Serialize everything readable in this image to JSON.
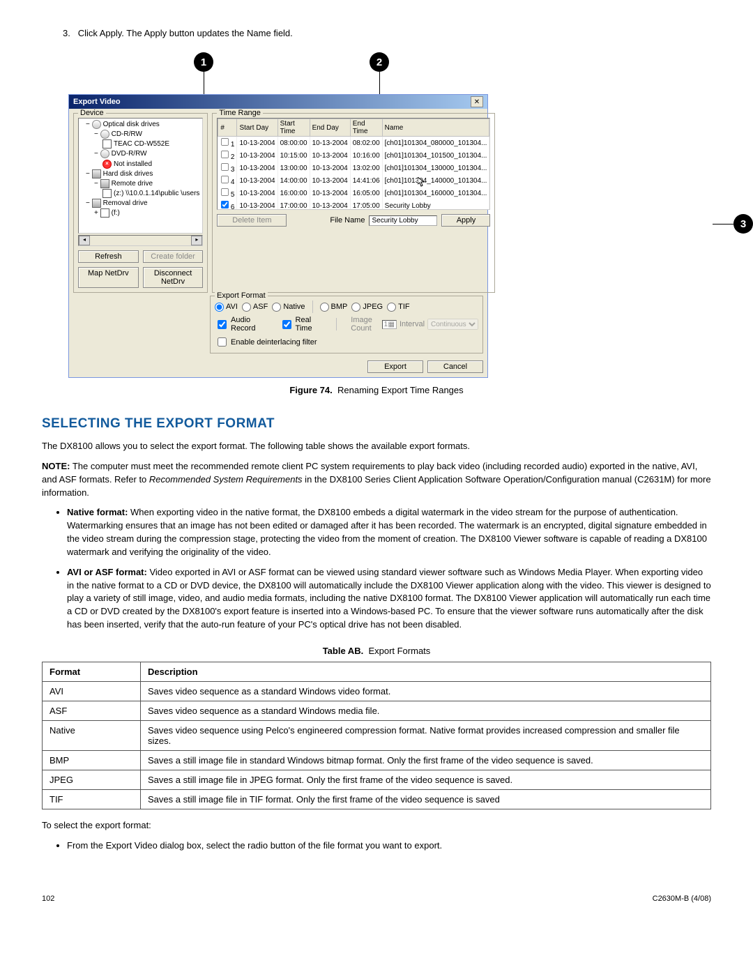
{
  "step": {
    "num": "3.",
    "text": "Click Apply. The Apply button updates the Name field."
  },
  "callouts": {
    "c1": "1",
    "c2": "2",
    "c3": "3"
  },
  "dialog": {
    "title": "Export Video",
    "close": "✕",
    "device_label": "Device",
    "tree": {
      "optical": "Optical disk drives",
      "cdrrw": "CD-R/RW",
      "teac": "TEAC    CD-W552E",
      "dvdrrw": "DVD-R/RW",
      "notinstalled": "Not installed",
      "hdd": "Hard disk drives",
      "remote": "Remote drive",
      "path": "(z:) \\\\10.0.1.14\\public \\users",
      "removal": "Removal drive",
      "f": "(f:)"
    },
    "refresh": "Refresh",
    "create_folder": "Create folder",
    "map_netdrv": "Map NetDrv",
    "disconnect_netdrv": "Disconnect NetDrv",
    "time_range_label": "Time Range",
    "cols": {
      "num": "#",
      "start_day": "Start Day",
      "start_time": "Start Time",
      "end_day": "End Day",
      "end_time": "End Time",
      "name": "Name"
    },
    "rows": [
      {
        "n": "1",
        "sd": "10-13-2004",
        "st": "08:00:00",
        "ed": "10-13-2004",
        "et": "08:02:00",
        "name": "[ch01]101304_080000_101304..."
      },
      {
        "n": "2",
        "sd": "10-13-2004",
        "st": "10:15:00",
        "ed": "10-13-2004",
        "et": "10:16:00",
        "name": "[ch01]101304_101500_101304..."
      },
      {
        "n": "3",
        "sd": "10-13-2004",
        "st": "13:00:00",
        "ed": "10-13-2004",
        "et": "13:02:00",
        "name": "[ch01]101304_130000_101304..."
      },
      {
        "n": "4",
        "sd": "10-13-2004",
        "st": "14:00:00",
        "ed": "10-13-2004",
        "et": "14:41:06",
        "name": "[ch01]101304_140000_101304..."
      },
      {
        "n": "5",
        "sd": "10-13-2004",
        "st": "16:00:00",
        "ed": "10-13-2004",
        "et": "16:05:00",
        "name": "[ch01]101304_160000_101304..."
      },
      {
        "n": "6",
        "sd": "10-13-2004",
        "st": "17:00:00",
        "ed": "10-13-2004",
        "et": "17:05:00",
        "name": "Security Lobby"
      }
    ],
    "delete_item": "Delete Item",
    "file_name_label": "File Name",
    "file_name_value": "Security Lobby",
    "apply": "Apply",
    "export_format_label": "Export Format",
    "fmt_avi": "AVI",
    "fmt_asf": "ASF",
    "fmt_native": "Native",
    "fmt_bmp": "BMP",
    "fmt_jpeg": "JPEG",
    "fmt_tif": "TIF",
    "audio_record": "Audio Record",
    "real_time": "Real Time",
    "image_count": "Image Count",
    "image_count_val": "1",
    "interval_label": "Interval",
    "interval_val": "Continuous",
    "deinterlace": "Enable deinterlacing filter",
    "export_btn": "Export",
    "cancel_btn": "Cancel"
  },
  "figure_caption_label": "Figure 74.",
  "figure_caption_text": "Renaming Export Time Ranges",
  "section_heading": "SELECTING THE EXPORT FORMAT",
  "para_intro": "The DX8100 allows you to select the export format. The following table shows the available export formats.",
  "note_label": "NOTE:",
  "note_body_a": "The computer must meet the recommended remote client PC system requirements to play back video (including recorded audio) exported in the native, AVI, and ASF formats.  Refer to ",
  "note_body_italic": "Recommended System Requirements",
  "note_body_b": " in the DX8100 Series Client Application Software Operation/Configuration manual (C2631M) for more information.",
  "bullet1_label": "Native format:",
  "bullet1_text": " When exporting video in the native format, the DX8100 embeds a digital watermark in the video stream for the purpose of authentication. Watermarking ensures that an image has not been edited or damaged after it has been recorded. The watermark is an encrypted, digital signature embedded in the video stream during the compression stage, protecting the video from the moment of creation. The DX8100 Viewer software is capable of reading a DX8100 watermark and verifying the originality of the video.",
  "bullet2_label": "AVI or ASF format:",
  "bullet2_text": " Video exported in AVI or ASF format can be viewed using standard viewer software such as Windows Media Player. When exporting video in the native format to a CD or DVD device, the DX8100 will automatically include the DX8100 Viewer application along with the video. This viewer is designed to play a variety of still image, video, and audio media formats, including the native DX8100 format. The DX8100 Viewer application will automatically run each time a CD or DVD created by the DX8100's export feature is inserted into a Windows-based PC. To ensure that the viewer software runs automatically after the disk has been inserted, verify that the auto-run feature of your PC's optical drive has not been disabled.",
  "table_caption_label": "Table AB.",
  "table_caption_text": "Export Formats",
  "th_format": "Format",
  "th_desc": "Description",
  "trows": [
    {
      "f": "AVI",
      "d": "Saves video sequence as a standard Windows video format."
    },
    {
      "f": "ASF",
      "d": "Saves video sequence as a standard Windows media file."
    },
    {
      "f": "Native",
      "d": "Saves video sequence using Pelco's engineered compression format. Native format provides increased compression and smaller file sizes."
    },
    {
      "f": "BMP",
      "d": "Saves a still image file in standard Windows bitmap format. Only the first frame of the video sequence is saved."
    },
    {
      "f": "JPEG",
      "d": "Saves a still image file in JPEG format. Only the first frame of the video sequence is saved."
    },
    {
      "f": "TIF",
      "d": "Saves a still image file in TIF format. Only the first frame of the video sequence is saved"
    }
  ],
  "post_table": "To select the export format:",
  "post_bullet": "From the Export Video dialog box, select the radio button of the file format you want to export.",
  "footer_left": "102",
  "footer_right": "C2630M-B (4/08)"
}
